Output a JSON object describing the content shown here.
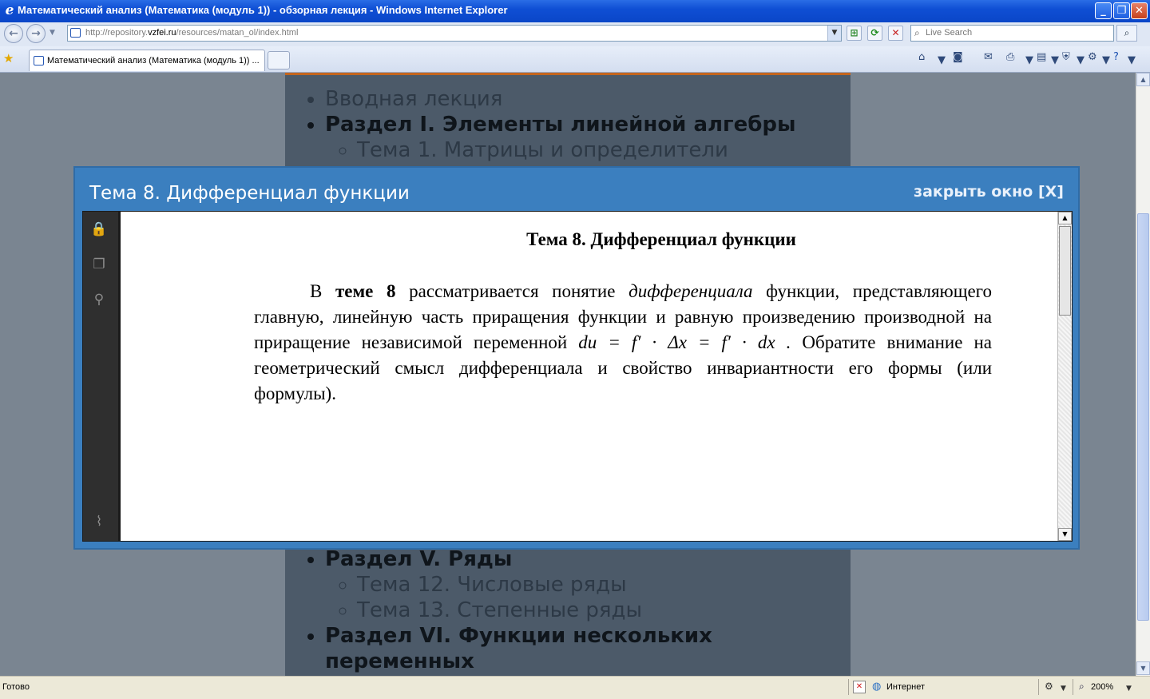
{
  "window": {
    "title": "Математический анализ (Математика (модуль 1)) - обзорная лекция - Windows Internet Explorer",
    "minimize": "_",
    "restore": "❐",
    "close": "✕"
  },
  "address": {
    "url_prefix": "http://repository.",
    "url_domain": "vzfei.ru",
    "url_suffix": "/resources/matan_ol/index.html"
  },
  "search": {
    "placeholder": "Live Search"
  },
  "tab": {
    "label": "Математический анализ (Математика (модуль 1)) ..."
  },
  "page": {
    "list": [
      {
        "text": "Вводная лекция",
        "style": "light"
      },
      {
        "text": "Раздел I. Элементы линейной алгебры",
        "style": "bold",
        "children": [
          "Тема 1. Матрицы и определители"
        ]
      },
      {
        "text": "Раздел V. Ряды",
        "style": "bold",
        "children": [
          "Тема 12. Числовые ряды",
          "Тема 13. Степенные ряды"
        ]
      },
      {
        "text": "Раздел VI. Функции нескольких переменных",
        "style": "bold"
      }
    ]
  },
  "modal": {
    "title": "Тема 8. Дифференциал функции",
    "close_label": "закрыть окно [X]",
    "doc_heading": "Тема 8. Дифференциал функции",
    "para_start": "В",
    "para_bold": "теме 8",
    "para_mid": "рассматривается понятие",
    "para_italic": "дифференциала",
    "para_rest": "функции, представляющего главную, линейную часть приращения функции и равную произведению производной на приращение независимой переменной",
    "formula": "du = f′ · Δx = f′ · dx .",
    "para_end": "Обратите внимание на геометрический смысл дифференциала и свойство инвариантности его формы (или формулы)."
  },
  "status": {
    "ready": "Готово",
    "zone": "Интернет",
    "zoom": "200%"
  }
}
